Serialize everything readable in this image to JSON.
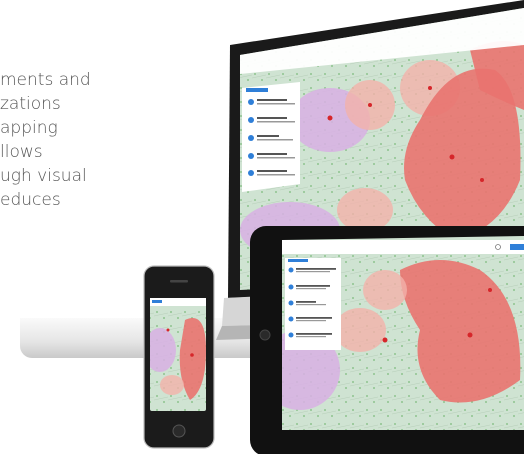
{
  "marketing": {
    "lines": [
      "ments and",
      "zations",
      "apping",
      "llows",
      "ugh visual",
      "educes"
    ]
  },
  "laptop_app": {
    "sidebar_tab": "Layer list",
    "search_placeholder": "Search",
    "layers": [
      {
        "title": "Current Incidents"
      },
      {
        "title": "Fire Weather"
      },
      {
        "title": "Smoke Forecast"
      },
      {
        "title": "Fire Perimeters"
      },
      {
        "title": "Red Flag Warnings"
      }
    ]
  },
  "tablet_app": {
    "sidebar_tab": "Layer list",
    "layers": [
      {
        "title": "Current Incidents"
      },
      {
        "title": "Fire Weather"
      },
      {
        "title": "Smoke Forecast"
      },
      {
        "title": "Fire Perimeters"
      },
      {
        "title": "Red Flag Warnings"
      }
    ]
  },
  "colors": {
    "map_base": "#cfe3d2",
    "hazard": "#e9736f",
    "hazard_light": "#f3b1aa",
    "purple_zone": "#d8b0e4",
    "accent": "#2f7fd8"
  }
}
